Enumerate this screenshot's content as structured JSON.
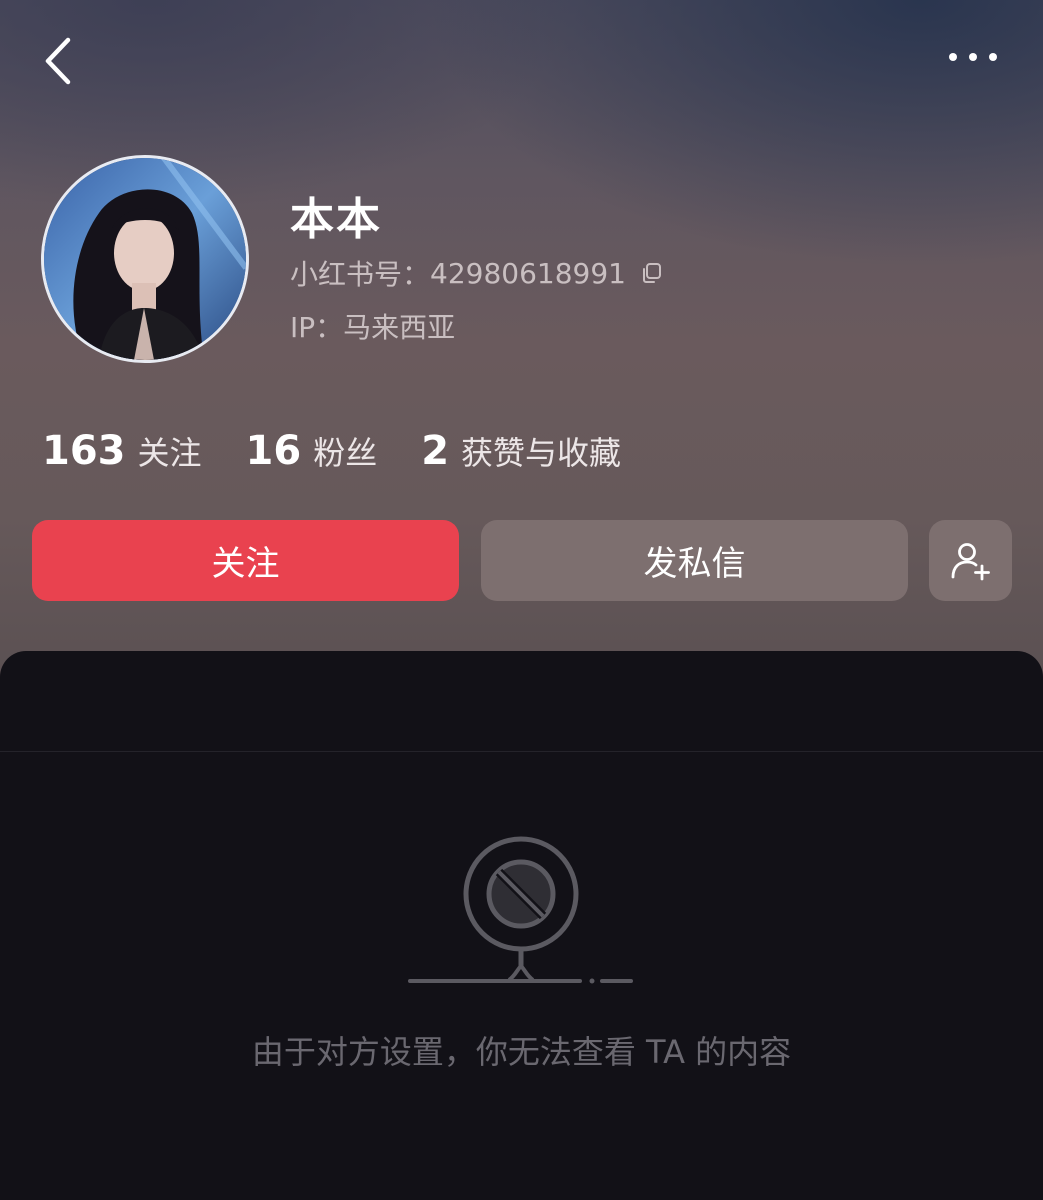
{
  "nav": {
    "back_icon": "chevron-left-icon",
    "more_icon": "more-dots-icon"
  },
  "profile": {
    "avatar_icon": "avatar-photo",
    "name": "本本",
    "id_label": "小红书号：",
    "id_value": "42980618991",
    "copy_icon": "copy-icon",
    "ip_label": "IP：",
    "ip_value": "马来西亚"
  },
  "stats": [
    {
      "value": "163",
      "label": "关注"
    },
    {
      "value": "16",
      "label": "粉丝"
    },
    {
      "value": "2",
      "label": "获赞与收藏"
    }
  ],
  "actions": {
    "follow_label": "关注",
    "message_label": "发私信",
    "add_user_icon": "add-user-icon"
  },
  "content": {
    "blocked_icon": "blocked-sign-icon",
    "blocked_message": "由于对方设置，你无法查看 TA 的内容"
  },
  "colors": {
    "follow_button": "#e9424f",
    "secondary_button": "#7d6f6f",
    "panel_background": "#121117",
    "muted_text": "#6a6870"
  }
}
